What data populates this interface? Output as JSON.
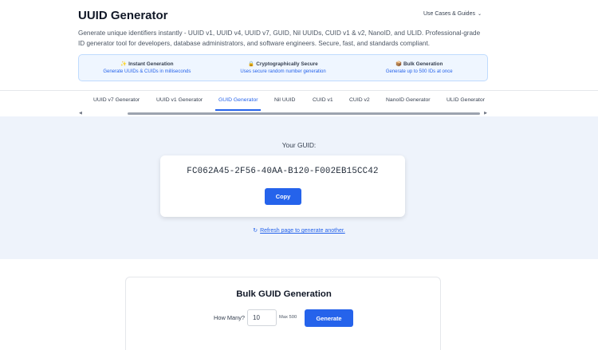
{
  "header": {
    "title": "UUID Generator",
    "menu_label": "Use Cases & Guides",
    "description": "Generate unique identifiers instantly - UUID v1, UUID v4, UUID v7, GUID, Nil UUIDs, CUID v1 & v2, NanoID, and ULID. Professional-grade ID generator tool for developers, database administrators, and software engineers. Secure, fast, and standards compliant."
  },
  "features": [
    {
      "icon": "sparkles-icon",
      "glyph": "✨",
      "title": "Instant Generation",
      "subtitle": "Generate UUIDs & CUIDs in milliseconds"
    },
    {
      "icon": "lock-icon",
      "glyph": "🔒",
      "title": "Cryptographically Secure",
      "subtitle": "Uses secure random number generation"
    },
    {
      "icon": "package-icon",
      "glyph": "📦",
      "title": "Bulk Generation",
      "subtitle": "Generate up to 500 IDs at once"
    }
  ],
  "tabs": [
    {
      "label": "UUID v7 Generator"
    },
    {
      "label": "UUID v1 Generator"
    },
    {
      "label": "GUID Generator",
      "active": true
    },
    {
      "label": "Nil UUID"
    },
    {
      "label": "CUID v1"
    },
    {
      "label": "CUID v2"
    },
    {
      "label": "NanoID Generator"
    },
    {
      "label": "ULID Generator"
    }
  ],
  "hero": {
    "label": "Your GUID:",
    "guid": "FC062A45-2F56-40AA-B120-F002EB15CC42",
    "copy_label": "Copy",
    "refresh_label": "Refresh page to generate another."
  },
  "bulk": {
    "title": "Bulk GUID Generation",
    "how_many_label": "How Many?",
    "quantity": "10",
    "max_label": "Max 500",
    "generate_label": "Generate"
  },
  "colors": {
    "accent": "#2563eb",
    "hero_bg": "#eef3fb",
    "feature_bg": "#eff6ff"
  }
}
